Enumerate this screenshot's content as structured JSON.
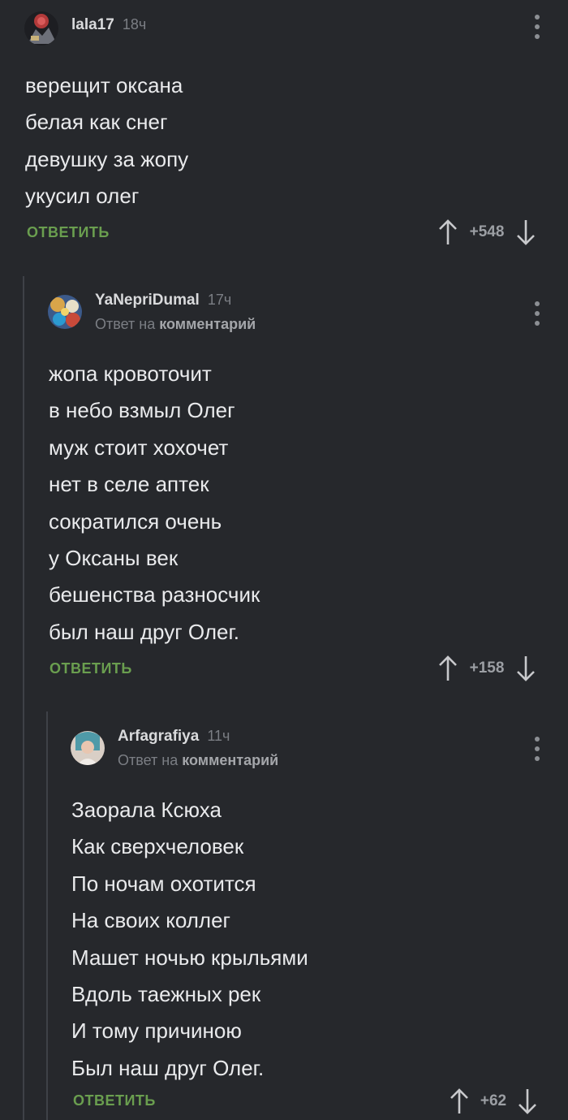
{
  "comments": [
    {
      "username": "lala17",
      "time": "18ч",
      "lines": [
        "верещит оксана",
        "белая как снег",
        "девушку за жопу",
        "укусил олег"
      ],
      "reply_label": "ОТВЕТИТЬ",
      "score": "+548"
    },
    {
      "username": "YaNepriDumal",
      "time": "17ч",
      "reply_to_prefix": "Ответ на",
      "reply_to_link": "комментарий",
      "lines": [
        "жопа кровоточит",
        "в небо взмыл Олег",
        "муж стоит хохочет",
        "нет в селе аптек",
        "сократился очень",
        "у Оксаны век",
        "бешенства разносчик",
        "был наш друг Олег."
      ],
      "reply_label": "ОТВЕТИТЬ",
      "score": "+158"
    },
    {
      "username": "Arfagrafiya",
      "time": "11ч",
      "reply_to_prefix": "Ответ на",
      "reply_to_link": "комментарий",
      "lines": [
        "Заорала Ксюха",
        "Как сверхчеловек",
        "По ночам охотится",
        "На своих коллег",
        "Машет ночью крыльями",
        "Вдоль таежных рек",
        "И тому причиною",
        "Был наш друг Олег."
      ],
      "reply_label": "ОТВЕТИТЬ",
      "score": "+62"
    }
  ],
  "colors": {
    "background": "#26282c",
    "reply_link": "#6a9e4f",
    "thread_line": "#3e4147"
  },
  "icons": [
    "avatar",
    "more-vertical-icon",
    "arrow-up-icon",
    "arrow-down-icon"
  ]
}
